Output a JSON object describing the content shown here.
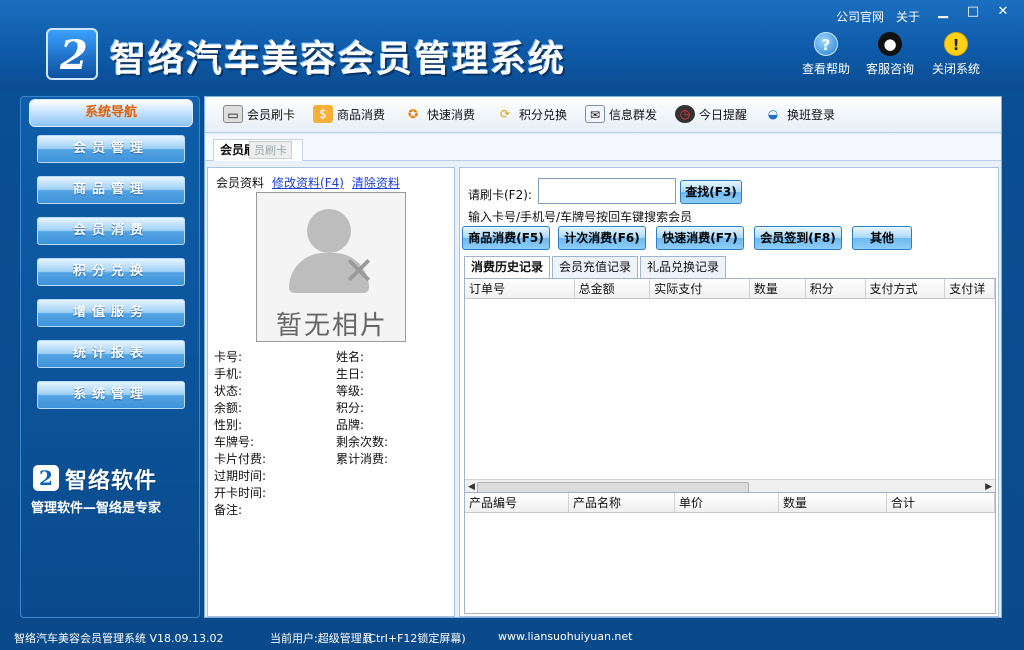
{
  "header": {
    "title": "智络汽车美容会员管理系统",
    "top_links": [
      "公司官网",
      "关于"
    ],
    "window_buttons": [
      "minimize-icon",
      "maximize-icon",
      "close-icon"
    ],
    "tools": [
      {
        "label": "查看帮助",
        "icon": "help-icon"
      },
      {
        "label": "客服咨询",
        "icon": "qq-icon"
      },
      {
        "label": "关闭系统",
        "icon": "warning-icon"
      }
    ]
  },
  "nav": {
    "title": "系统导航",
    "items": [
      "会员管理",
      "商品管理",
      "会员消费",
      "积分兑换",
      "增值服务",
      "统计报表",
      "系统管理"
    ],
    "brand_name": "智络软件",
    "brand_slogan": "管理软件—智络是专家"
  },
  "toolbar": {
    "items": [
      {
        "label": "会员刷卡",
        "icon": "card-icon"
      },
      {
        "label": "商品消费",
        "icon": "money-bag-icon"
      },
      {
        "label": "快速消费",
        "icon": "fast-icon"
      },
      {
        "label": "积分兑换",
        "icon": "exchange-icon"
      },
      {
        "label": "信息群发",
        "icon": "mail-icon"
      },
      {
        "label": "今日提醒",
        "icon": "clock-icon"
      },
      {
        "label": "换班登录",
        "icon": "login-icon"
      }
    ]
  },
  "tab": {
    "active": "会员刷卡",
    "ghost": "员刷卡"
  },
  "member": {
    "legend": "会员资料",
    "edit_link": "修改资料(F4)",
    "clear_link": "清除资料",
    "photo_text": "暂无相片",
    "left_fields": [
      "卡号:",
      "手机:",
      "状态:",
      "余额:",
      "性别:",
      "车牌号:",
      "卡片付费:",
      "过期时间:",
      "开卡时间:",
      "备注:"
    ],
    "right_fields": [
      "姓名:",
      "生日:",
      "等级:",
      "积分:",
      "品牌:",
      "剩余次数:",
      "累计消费:"
    ]
  },
  "swipe": {
    "label": "请刷卡(F2):",
    "input_value": "",
    "search_button": "查找(F3)",
    "hint": "输入卡号/手机号/车牌号按回车键搜索会员"
  },
  "actions": [
    "商品消费(F5)",
    "计次消费(F6)",
    "快速消费(F7)",
    "会员签到(F8)",
    "其他"
  ],
  "history_tabs": [
    "消费历史记录",
    "会员充值记录",
    "礼品兑换记录"
  ],
  "orders_table": {
    "columns": [
      "订单号",
      "总金额",
      "实际支付",
      "数量",
      "积分",
      "支付方式",
      "支付详"
    ],
    "rows": []
  },
  "items_table": {
    "columns": [
      "产品编号",
      "产品名称",
      "单价",
      "数量",
      "合计"
    ],
    "rows": []
  },
  "status": {
    "app_info": "智络汽车美容会员管理系统 V18.09.13.02",
    "user": "当前用户:超级管理员",
    "hint": "(Ctrl+F12锁定屏幕)",
    "website": "www.liansuohuiyuan.net"
  }
}
